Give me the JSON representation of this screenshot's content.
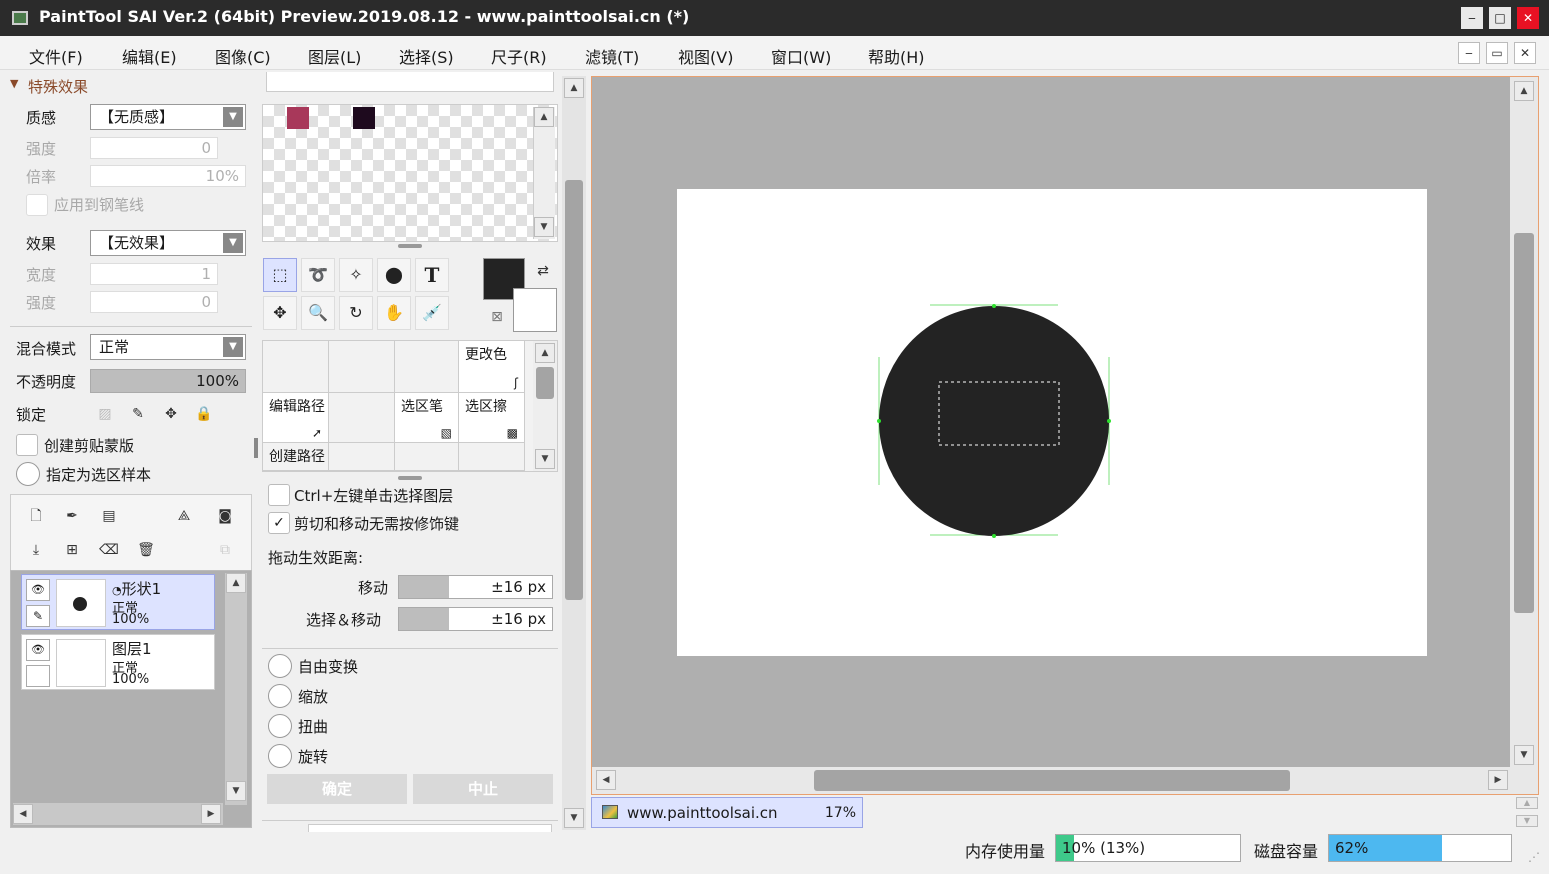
{
  "window": {
    "title": "PaintTool SAI Ver.2 (64bit) Preview.2019.08.12 - www.painttoolsai.cn (*)",
    "btn_min": "‒",
    "btn_max": "□",
    "btn_close": "✕"
  },
  "menu": [
    "文件(F)",
    "编辑(E)",
    "图像(C)",
    "图层(L)",
    "选择(S)",
    "尺子(R)",
    "滤镜(T)",
    "视图(V)",
    "窗口(W)",
    "帮助(H)"
  ],
  "mdi": {
    "min": "‒",
    "restore": "▭",
    "close": "✕"
  },
  "effects": {
    "header": "特殊效果",
    "texture_label": "质感",
    "texture_value": "【无质感】",
    "strength_label": "强度",
    "strength_value": "0",
    "scale_label": "倍率",
    "scale_value": "10%",
    "apply_pen_label": "应用到钢笔线",
    "effect_label": "效果",
    "effect_value": "【无效果】",
    "width_label": "宽度",
    "width_value": "1",
    "strength2_label": "强度",
    "strength2_value": "0"
  },
  "layer_props": {
    "blend_label": "混合模式",
    "blend_value": "正常",
    "opacity_label": "不透明度",
    "opacity_value": "100%",
    "opacity_fraction": 1.0,
    "lock_label": "锁定",
    "clip_label": "创建剪贴蒙版",
    "sample_label": "指定为选区样本"
  },
  "layers": [
    {
      "name": "形状1",
      "mode": "正常",
      "opacity": "100%"
    },
    {
      "name": "图层1",
      "mode": "正常",
      "opacity": "100%"
    }
  ],
  "swatches": {
    "colors": [
      "#a8385a",
      "#1e0a1e"
    ]
  },
  "colors": {
    "primary": "#232323",
    "secondary": "#ffffff",
    "accent": "#99a4e6",
    "progress_mem": "#3ec98a",
    "progress_disk": "#4db8f0"
  },
  "shortcuts": {
    "change_color": "更改色",
    "edit_path": "编辑路径",
    "sel_pen": "选区笔",
    "sel_erase": "选区擦",
    "create_path": "创建路径"
  },
  "options": {
    "ctrl_click_label": "Ctrl+左键单击选择图层",
    "cut_move_label": "剪切和移动无需按修饰键",
    "drag_label": "拖动生效距离:",
    "move_label": "移动",
    "move_value": "±16 px",
    "selmove_label": "选择＆移动",
    "selmove_value": "±16 px",
    "free_transform": "自由变换",
    "scale": "缩放",
    "distort": "扭曲",
    "rotate": "旋转",
    "ok_label": "确定",
    "cancel_label": "中止"
  },
  "tab": {
    "name": "www.painttoolsai.cn",
    "zoom": "17%"
  },
  "status": {
    "mem_label": "内存使用量",
    "mem_value": "10% (13%)",
    "mem_fraction": 0.1,
    "disk_label": "磁盘容量",
    "disk_value": "62%",
    "disk_fraction": 0.62
  },
  "tools": {
    "text_glyph": "T"
  }
}
